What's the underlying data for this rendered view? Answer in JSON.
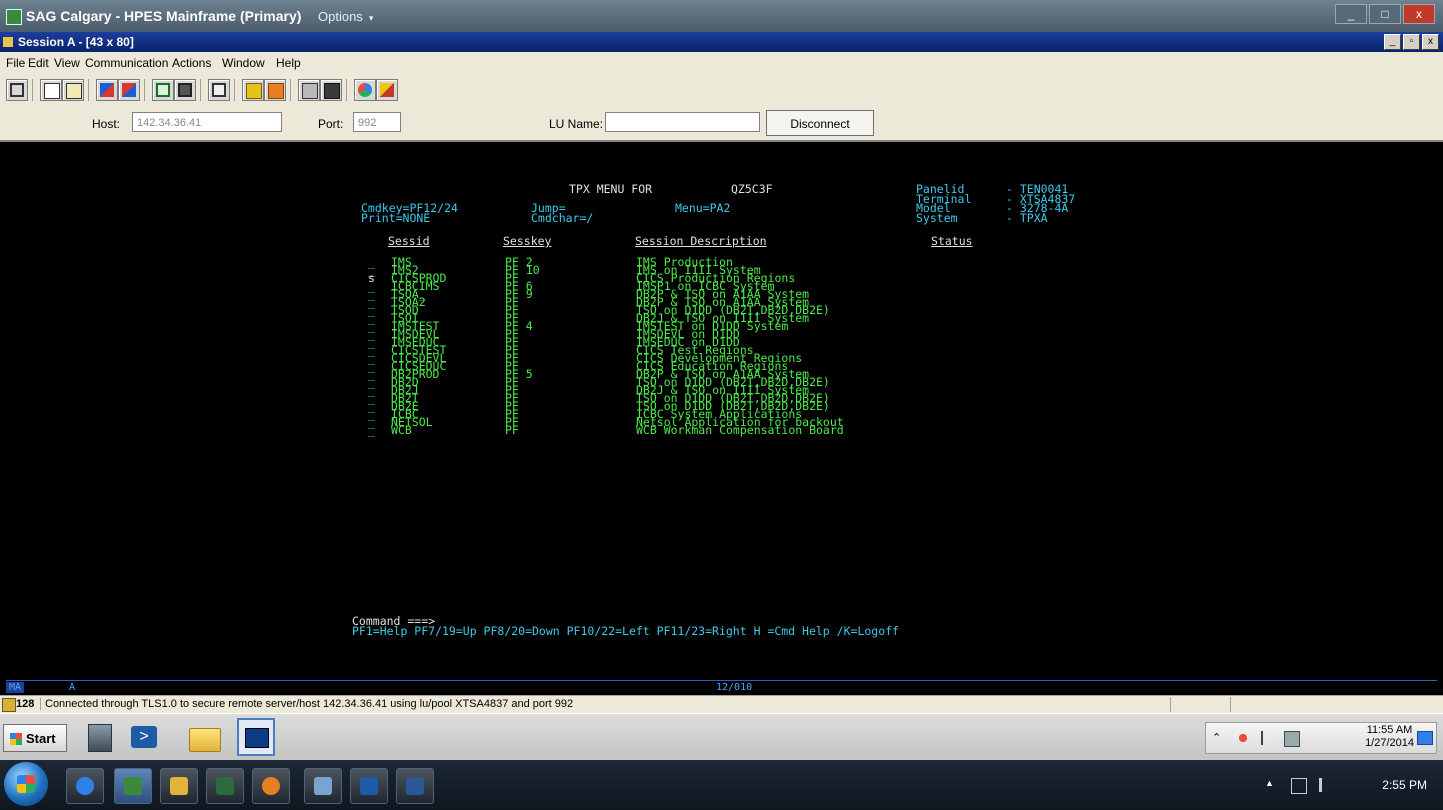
{
  "app": {
    "title": "SAG Calgary - HPES Mainframe (Primary)",
    "options_label": "Options",
    "options_arrow": "▾",
    "window_buttons": [
      "_",
      "□",
      "x"
    ]
  },
  "session": {
    "title": "Session A - [43 x 80]",
    "buttons": [
      "_",
      "▫",
      "x"
    ]
  },
  "menu": [
    "File",
    "Edit",
    "View",
    "Communication",
    "Actions",
    "Window",
    "Help"
  ],
  "toolbar": {
    "icons": [
      "screen-icon",
      "copy-icon",
      "paste-icon",
      "send-icon",
      "receive-icon",
      "display-icon",
      "record-icon",
      "print-icon",
      "macro-play-icon",
      "macro-record-icon",
      "keyboard-icon",
      "map-icon",
      "color-icon",
      "edit-icon"
    ]
  },
  "connection": {
    "host_label": "Host:",
    "host_value": "142.34.36.41",
    "port_label": "Port:",
    "port_value": "992",
    "lu_label": "LU Name:",
    "lu_value": "",
    "disconnect_label": "Disconnect"
  },
  "terminal": {
    "header_title": "TPX MENU FOR",
    "header_id": "QZ5C3F",
    "panel_info": [
      {
        "label": "Panelid",
        "value": "- TEN0041"
      },
      {
        "label": "Terminal",
        "value": "- XTSA4837"
      },
      {
        "label": "Model",
        "value": "- 3278-4A"
      },
      {
        "label": "System",
        "value": "- TPXA"
      }
    ],
    "cmdkey": "Cmdkey=PF12/24",
    "jump": "Jump=",
    "menu_key": "Menu=PA2",
    "print": "Print=NONE",
    "cmdchar": "Cmdchar=/",
    "columns": {
      "sessid": "Sessid",
      "sesskey": "Sesskey",
      "description": "Session Description",
      "status": "Status"
    },
    "rows": [
      {
        "sel": "_",
        "id": "IMS",
        "key": "PF 2",
        "desc": "IMS Production"
      },
      {
        "sel": "_",
        "id": "IMS2",
        "key": "PF 10",
        "desc": "IMS on I1II System"
      },
      {
        "sel": "s",
        "id": "CICSPROD",
        "key": "PF",
        "desc": "CICS Production Regions"
      },
      {
        "sel": "_",
        "id": "ICBCIMS",
        "key": "PF 6",
        "desc": "IMSP1 on ICBC System"
      },
      {
        "sel": "_",
        "id": "TSOA_",
        "key": "PF 9",
        "desc": "DB2P & TSO on A1AA System"
      },
      {
        "sel": "_",
        "id": "TSOA2",
        "key": "PF",
        "desc": "DB2P & TSO on A1AA System"
      },
      {
        "sel": "_",
        "id": "TSOD",
        "key": "PF",
        "desc": "TSO on D1DD (DB2T,DB2D,DB2E)"
      },
      {
        "sel": "_",
        "id": "TSOI",
        "key": "PF",
        "desc": "DB2J & TSO on I1II System"
      },
      {
        "sel": "_",
        "id": "IMSTEST",
        "key": "PF 4",
        "desc": "IMSTEST on D1DD System"
      },
      {
        "sel": "_",
        "id": "IMSDEVL",
        "key": "PF",
        "desc": "IMSDEVL on D1DD"
      },
      {
        "sel": "_",
        "id": "IMSEDUC",
        "key": "PF",
        "desc": "IMSEDUC on D1DD"
      },
      {
        "sel": "_",
        "id": "CICSTEST",
        "key": "PF",
        "desc": "CICS Test Regions"
      },
      {
        "sel": "_",
        "id": "CICSDEVL",
        "key": "PF",
        "desc": "CICS Development Regions"
      },
      {
        "sel": "_",
        "id": "CICSEDUC",
        "key": "PF",
        "desc": "CICS Education Regions"
      },
      {
        "sel": "_",
        "id": "DB2PROD",
        "key": "PF 5",
        "desc": "DB2P & TSO on A1AA System"
      },
      {
        "sel": "_",
        "id": "DB2D",
        "key": "PF",
        "desc": "TSO on D1DD (DB2T,DB2D,DB2E)"
      },
      {
        "sel": "_",
        "id": "DB2J",
        "key": "PF",
        "desc": "DB2J & TSO on I1II System"
      },
      {
        "sel": "_",
        "id": "DB2T",
        "key": "PF",
        "desc": "TSO on D1DD (DB2T,DB2D,DB2E)"
      },
      {
        "sel": "_",
        "id": "DB2E",
        "key": "PF",
        "desc": "TSO on D1DD (DB2T,DB2D,DB2E)"
      },
      {
        "sel": "_",
        "id": "ICBC",
        "key": "PF",
        "desc": "ICBC System Applications"
      },
      {
        "sel": "_",
        "id": "NETSOL",
        "key": "PF",
        "desc": "Netsol Application for backout"
      },
      {
        "sel": "_",
        "id": "WCB",
        "key": "PF",
        "desc": "WCB Workman Compensation Board"
      }
    ],
    "command_prompt": "Command ===>",
    "pf_help": "PF1=Help PF7/19=Up PF8/20=Down PF10/22=Left PF11/23=Right H =Cmd Help /K=Logoff"
  },
  "oia": {
    "mode": "MA",
    "indicator": "A",
    "cursor_pos": "12/010"
  },
  "status": {
    "number": "128",
    "message": "Connected through TLS1.0 to secure remote server/host 142.34.36.41 using lu/pool XTSA4837 and port 992"
  },
  "inner_taskbar": {
    "start_label": "Start",
    "clock_time": "11:55 AM",
    "clock_date": "1/27/2014",
    "tray_arrow": "⌃"
  },
  "outer_taskbar": {
    "clock_time": "2:55 PM",
    "tray_arrow": "▲"
  },
  "colors": {
    "terminal_green": "#4dea4d",
    "terminal_cyan": "#40c8e8",
    "title_blue": "#0a246a"
  }
}
